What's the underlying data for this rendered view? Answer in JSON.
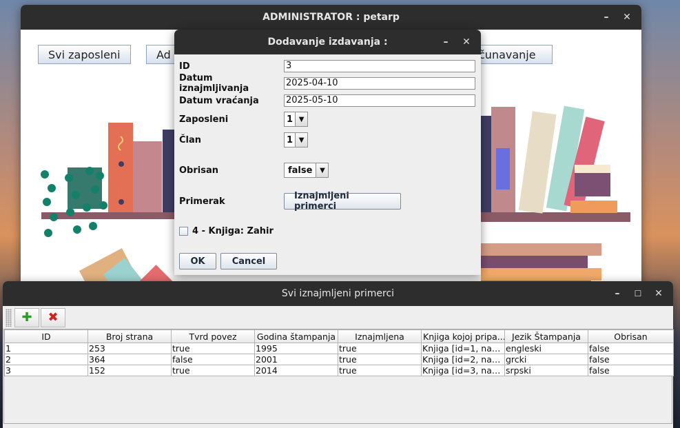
{
  "main_window": {
    "title": "ADMINISTRATOR : petarp",
    "nav": {
      "svi_zaposleni": "Svi zaposleni",
      "ad": "Ad",
      "racunavanje": "čunavanje"
    },
    "controls": {
      "minimize": "–",
      "close": "✕"
    }
  },
  "dialog": {
    "title": "Dodavanje izdavanja :",
    "controls": {
      "minimize": "–",
      "close": "✕"
    },
    "fields": {
      "id": {
        "label": "ID",
        "value": "3"
      },
      "datum_iznajmljivanja": {
        "label": "Datum iznajmljivanja",
        "value": "2025-04-10"
      },
      "datum_vracanja": {
        "label": "Datum vraćanja",
        "value": "2025-05-10"
      },
      "zaposleni": {
        "label": "Zaposleni",
        "value": "1"
      },
      "clan": {
        "label": "Član",
        "value": "1"
      },
      "obrisan": {
        "label": "Obrisan",
        "value": "false"
      },
      "primerak": {
        "label": "Primerak",
        "button": "Iznajmljeni primerci"
      }
    },
    "checkbox_label": "4 - Knjiga: Zahir",
    "ok": "OK",
    "cancel": "Cancel"
  },
  "table_window": {
    "title": "Svi iznajmljeni primerci",
    "controls": {
      "minimize": "–",
      "maximize": "☐",
      "close": "✕"
    },
    "columns": [
      "ID",
      "Broj strana",
      "Tvrd povez",
      "Godina štampanja",
      "Iznajmljena",
      "Knjiga kojoj pripa...",
      "Jezik Štampanja",
      "Obrisan"
    ],
    "rows": [
      [
        "1",
        "253",
        "true",
        "1995",
        "true",
        "Knjiga [id=1, nas...",
        "engleski",
        "false"
      ],
      [
        "2",
        "364",
        "false",
        "2001",
        "true",
        "Knjiga [id=2, nas...",
        "grcki",
        "false"
      ],
      [
        "3",
        "152",
        "true",
        "2014",
        "true",
        "Knjiga [id=3, nas...",
        "srpski",
        "false"
      ]
    ]
  },
  "icons": {
    "add": "plus-icon",
    "delete": "cross-icon",
    "dropdown": "chevron-down-icon"
  },
  "colors": {
    "titlebar": "#2d2d2d",
    "window_bg": "#eeeeee",
    "add_icon": "#2f9a2a",
    "delete_icon": "#d0231f"
  }
}
